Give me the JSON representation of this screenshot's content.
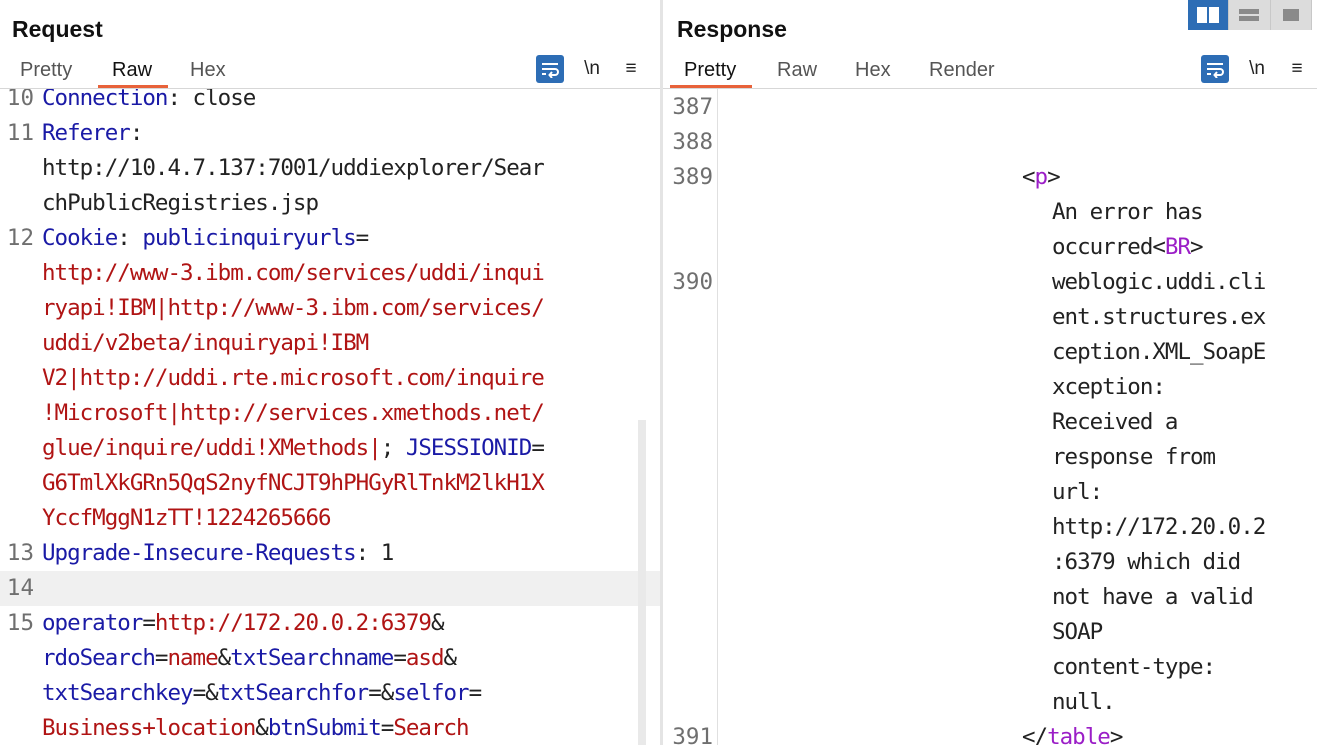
{
  "layout_switch": {
    "options": [
      "side-by-side",
      "stacked",
      "single"
    ],
    "active": "side-by-side",
    "accent": "#2d6db5"
  },
  "request": {
    "title": "Request",
    "tabs": [
      "Pretty",
      "Raw",
      "Hex"
    ],
    "active_tab": "Raw",
    "toolbar": {
      "newline_label": "\\n",
      "menu_label": "≡",
      "wrap_icon": "word-wrap-icon"
    },
    "lines": [
      {
        "num": "10",
        "segments": [
          {
            "c": "k",
            "t": "Connection"
          },
          {
            "c": "p",
            "t": ": close"
          }
        ]
      },
      {
        "num": "11",
        "segments": [
          {
            "c": "k",
            "t": "Referer"
          },
          {
            "c": "p",
            "t": ":"
          }
        ]
      },
      {
        "num": "",
        "segments": [
          {
            "c": "p",
            "t": "http://10.4.7.137:7001/uddiexplorer/Sear"
          }
        ]
      },
      {
        "num": "",
        "segments": [
          {
            "c": "p",
            "t": "chPublicRegistries.jsp"
          }
        ]
      },
      {
        "num": "12",
        "segments": [
          {
            "c": "k",
            "t": "Cookie"
          },
          {
            "c": "p",
            "t": ": "
          },
          {
            "c": "k",
            "t": "publicinquiryurls"
          },
          {
            "c": "p",
            "t": "="
          }
        ]
      },
      {
        "num": "",
        "segments": [
          {
            "c": "v",
            "t": "http://www-3.ibm.com/services/uddi/inqui"
          }
        ]
      },
      {
        "num": "",
        "segments": [
          {
            "c": "v",
            "t": "ryapi!IBM|http://www-3.ibm.com/services/"
          }
        ]
      },
      {
        "num": "",
        "segments": [
          {
            "c": "v",
            "t": "uddi/v2beta/inquiryapi!IBM"
          }
        ]
      },
      {
        "num": "",
        "segments": [
          {
            "c": "v",
            "t": "V2|http://uddi.rte.microsoft.com/inquire"
          }
        ]
      },
      {
        "num": "",
        "segments": [
          {
            "c": "v",
            "t": "!Microsoft|http://services.xmethods.net/"
          }
        ]
      },
      {
        "num": "",
        "segments": [
          {
            "c": "v",
            "t": "glue/inquire/uddi!XMethods|"
          },
          {
            "c": "p",
            "t": "; "
          },
          {
            "c": "k",
            "t": "JSESSIONID"
          },
          {
            "c": "p",
            "t": "="
          }
        ]
      },
      {
        "num": "",
        "segments": [
          {
            "c": "v",
            "t": "G6TmlXkGRn5QqS2nyfNCJT9hPHGyRlTnkM2lkH1X"
          }
        ]
      },
      {
        "num": "",
        "segments": [
          {
            "c": "v",
            "t": "YccfMggN1zTT!1224265666"
          }
        ]
      },
      {
        "num": "13",
        "segments": [
          {
            "c": "k",
            "t": "Upgrade-Insecure-Requests"
          },
          {
            "c": "p",
            "t": ": 1"
          }
        ]
      },
      {
        "num": "14",
        "segments": [],
        "highlight": true
      },
      {
        "num": "15",
        "segments": [
          {
            "c": "k",
            "t": "operator"
          },
          {
            "c": "p",
            "t": "="
          },
          {
            "c": "v",
            "t": "http://172.20.0.2:6379"
          },
          {
            "c": "p",
            "t": "&"
          }
        ]
      },
      {
        "num": "",
        "segments": [
          {
            "c": "k",
            "t": "rdoSearch"
          },
          {
            "c": "p",
            "t": "="
          },
          {
            "c": "v",
            "t": "name"
          },
          {
            "c": "p",
            "t": "&"
          },
          {
            "c": "k",
            "t": "txtSearchname"
          },
          {
            "c": "p",
            "t": "="
          },
          {
            "c": "v",
            "t": "asd"
          },
          {
            "c": "p",
            "t": "&"
          }
        ]
      },
      {
        "num": "",
        "segments": [
          {
            "c": "k",
            "t": "txtSearchkey"
          },
          {
            "c": "p",
            "t": "=&"
          },
          {
            "c": "k",
            "t": "txtSearchfor"
          },
          {
            "c": "p",
            "t": "=&"
          },
          {
            "c": "k",
            "t": "selfor"
          },
          {
            "c": "p",
            "t": "="
          }
        ]
      },
      {
        "num": "",
        "segments": [
          {
            "c": "v",
            "t": "Business+location"
          },
          {
            "c": "p",
            "t": "&"
          },
          {
            "c": "k",
            "t": "btnSubmit"
          },
          {
            "c": "p",
            "t": "="
          },
          {
            "c": "v",
            "t": "Search"
          }
        ]
      }
    ]
  },
  "response": {
    "title": "Response",
    "tabs": [
      "Pretty",
      "Raw",
      "Hex",
      "Render"
    ],
    "active_tab": "Pretty",
    "toolbar": {
      "newline_label": "\\n",
      "menu_label": "≡",
      "wrap_icon": "word-wrap-icon"
    },
    "lines": [
      {
        "num": "387",
        "indent": 0,
        "segments": []
      },
      {
        "num": "388",
        "indent": 0,
        "segments": []
      },
      {
        "num": "389",
        "indent": 300,
        "segments": [
          {
            "c": "p",
            "t": "<"
          },
          {
            "c": "t",
            "t": "p"
          },
          {
            "c": "p",
            "t": ">"
          }
        ]
      },
      {
        "num": "",
        "indent": 330,
        "segments": [
          {
            "c": "p",
            "t": "An error has"
          }
        ]
      },
      {
        "num": "",
        "indent": 330,
        "segments": [
          {
            "c": "p",
            "t": "occurred<"
          },
          {
            "c": "t",
            "t": "BR"
          },
          {
            "c": "p",
            "t": ">"
          }
        ]
      },
      {
        "num": "390",
        "indent": 330,
        "segments": [
          {
            "c": "p",
            "t": "weblogic.uddi.cli"
          }
        ]
      },
      {
        "num": "",
        "indent": 330,
        "segments": [
          {
            "c": "p",
            "t": "ent.structures.ex"
          }
        ]
      },
      {
        "num": "",
        "indent": 330,
        "segments": [
          {
            "c": "p",
            "t": "ception.XML_SoapE"
          }
        ]
      },
      {
        "num": "",
        "indent": 330,
        "segments": [
          {
            "c": "p",
            "t": "xception:"
          }
        ]
      },
      {
        "num": "",
        "indent": 330,
        "segments": [
          {
            "c": "p",
            "t": "Received a"
          }
        ]
      },
      {
        "num": "",
        "indent": 330,
        "segments": [
          {
            "c": "p",
            "t": "response from"
          }
        ]
      },
      {
        "num": "",
        "indent": 330,
        "segments": [
          {
            "c": "p",
            "t": "url:"
          }
        ]
      },
      {
        "num": "",
        "indent": 330,
        "segments": [
          {
            "c": "p",
            "t": "http://172.20.0.2"
          }
        ]
      },
      {
        "num": "",
        "indent": 330,
        "segments": [
          {
            "c": "p",
            "t": ":6379 which did"
          }
        ]
      },
      {
        "num": "",
        "indent": 330,
        "segments": [
          {
            "c": "p",
            "t": "not have a valid"
          }
        ]
      },
      {
        "num": "",
        "indent": 330,
        "segments": [
          {
            "c": "p",
            "t": "SOAP"
          }
        ]
      },
      {
        "num": "",
        "indent": 330,
        "segments": [
          {
            "c": "p",
            "t": "content-type:"
          }
        ]
      },
      {
        "num": "",
        "indent": 330,
        "segments": [
          {
            "c": "p",
            "t": "null."
          }
        ]
      },
      {
        "num": "391",
        "indent": 300,
        "segments": [
          {
            "c": "p",
            "t": "</"
          },
          {
            "c": "t",
            "t": "table"
          },
          {
            "c": "p",
            "t": ">"
          }
        ]
      }
    ]
  }
}
